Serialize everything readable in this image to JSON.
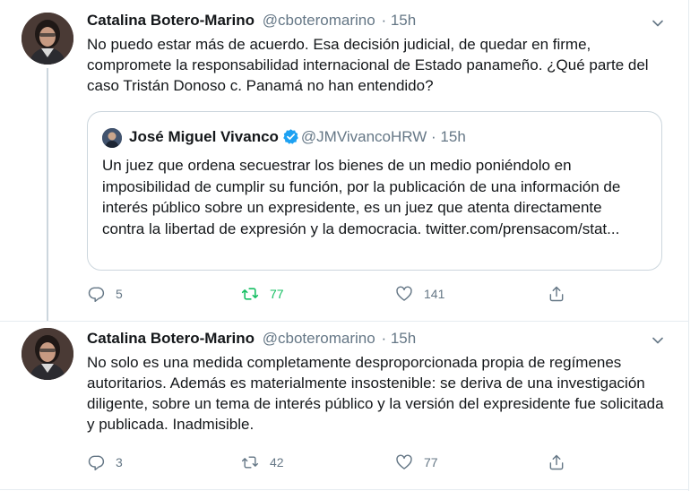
{
  "tweets": [
    {
      "name": "Catalina Botero-Marino",
      "handle": "@cboteromarino",
      "time": "· 15h",
      "text": "No puedo estar más de acuerdo. Esa decisión judicial, de quedar en firme, compromete la responsabilidad internacional de Estado panameño. ¿Qué parte del caso Tristán Donoso c. Panamá no han entendido?",
      "quote": {
        "name": "José Miguel Vivanco",
        "handle": "@JMVivancoHRW",
        "time": "· 15h",
        "text": "Un juez que ordena secuestrar los bienes de un medio poniéndolo en imposibilidad de cumplir su función, por la publicación de una información de interés público sobre un expresidente, es un juez que atenta directamente contra la libertad de expresión y la democracia. twitter.com/prensacom/stat..."
      },
      "replies": "5",
      "retweets": "77",
      "likes": "141"
    },
    {
      "name": "Catalina Botero-Marino",
      "handle": "@cboteromarino",
      "time": "· 15h",
      "text": "No solo es una medida completamente desproporcionada propia de regímenes autoritarios. Además es materialmente insostenible: se deriva de una investigación diligente, sobre un tema de interés público y la versión del expresidente fue solicitada y publicada. Inadmisible.",
      "replies": "3",
      "retweets": "42",
      "likes": "77"
    }
  ],
  "colors": {
    "text": "#14171a",
    "secondary": "#657786",
    "retweet_active": "#17bf63",
    "verified": "#1da1f2",
    "border": "#ccd6dd"
  },
  "icons": [
    "chevron-down-icon",
    "reply-icon",
    "retweet-icon",
    "like-icon",
    "share-icon",
    "verified-icon"
  ]
}
